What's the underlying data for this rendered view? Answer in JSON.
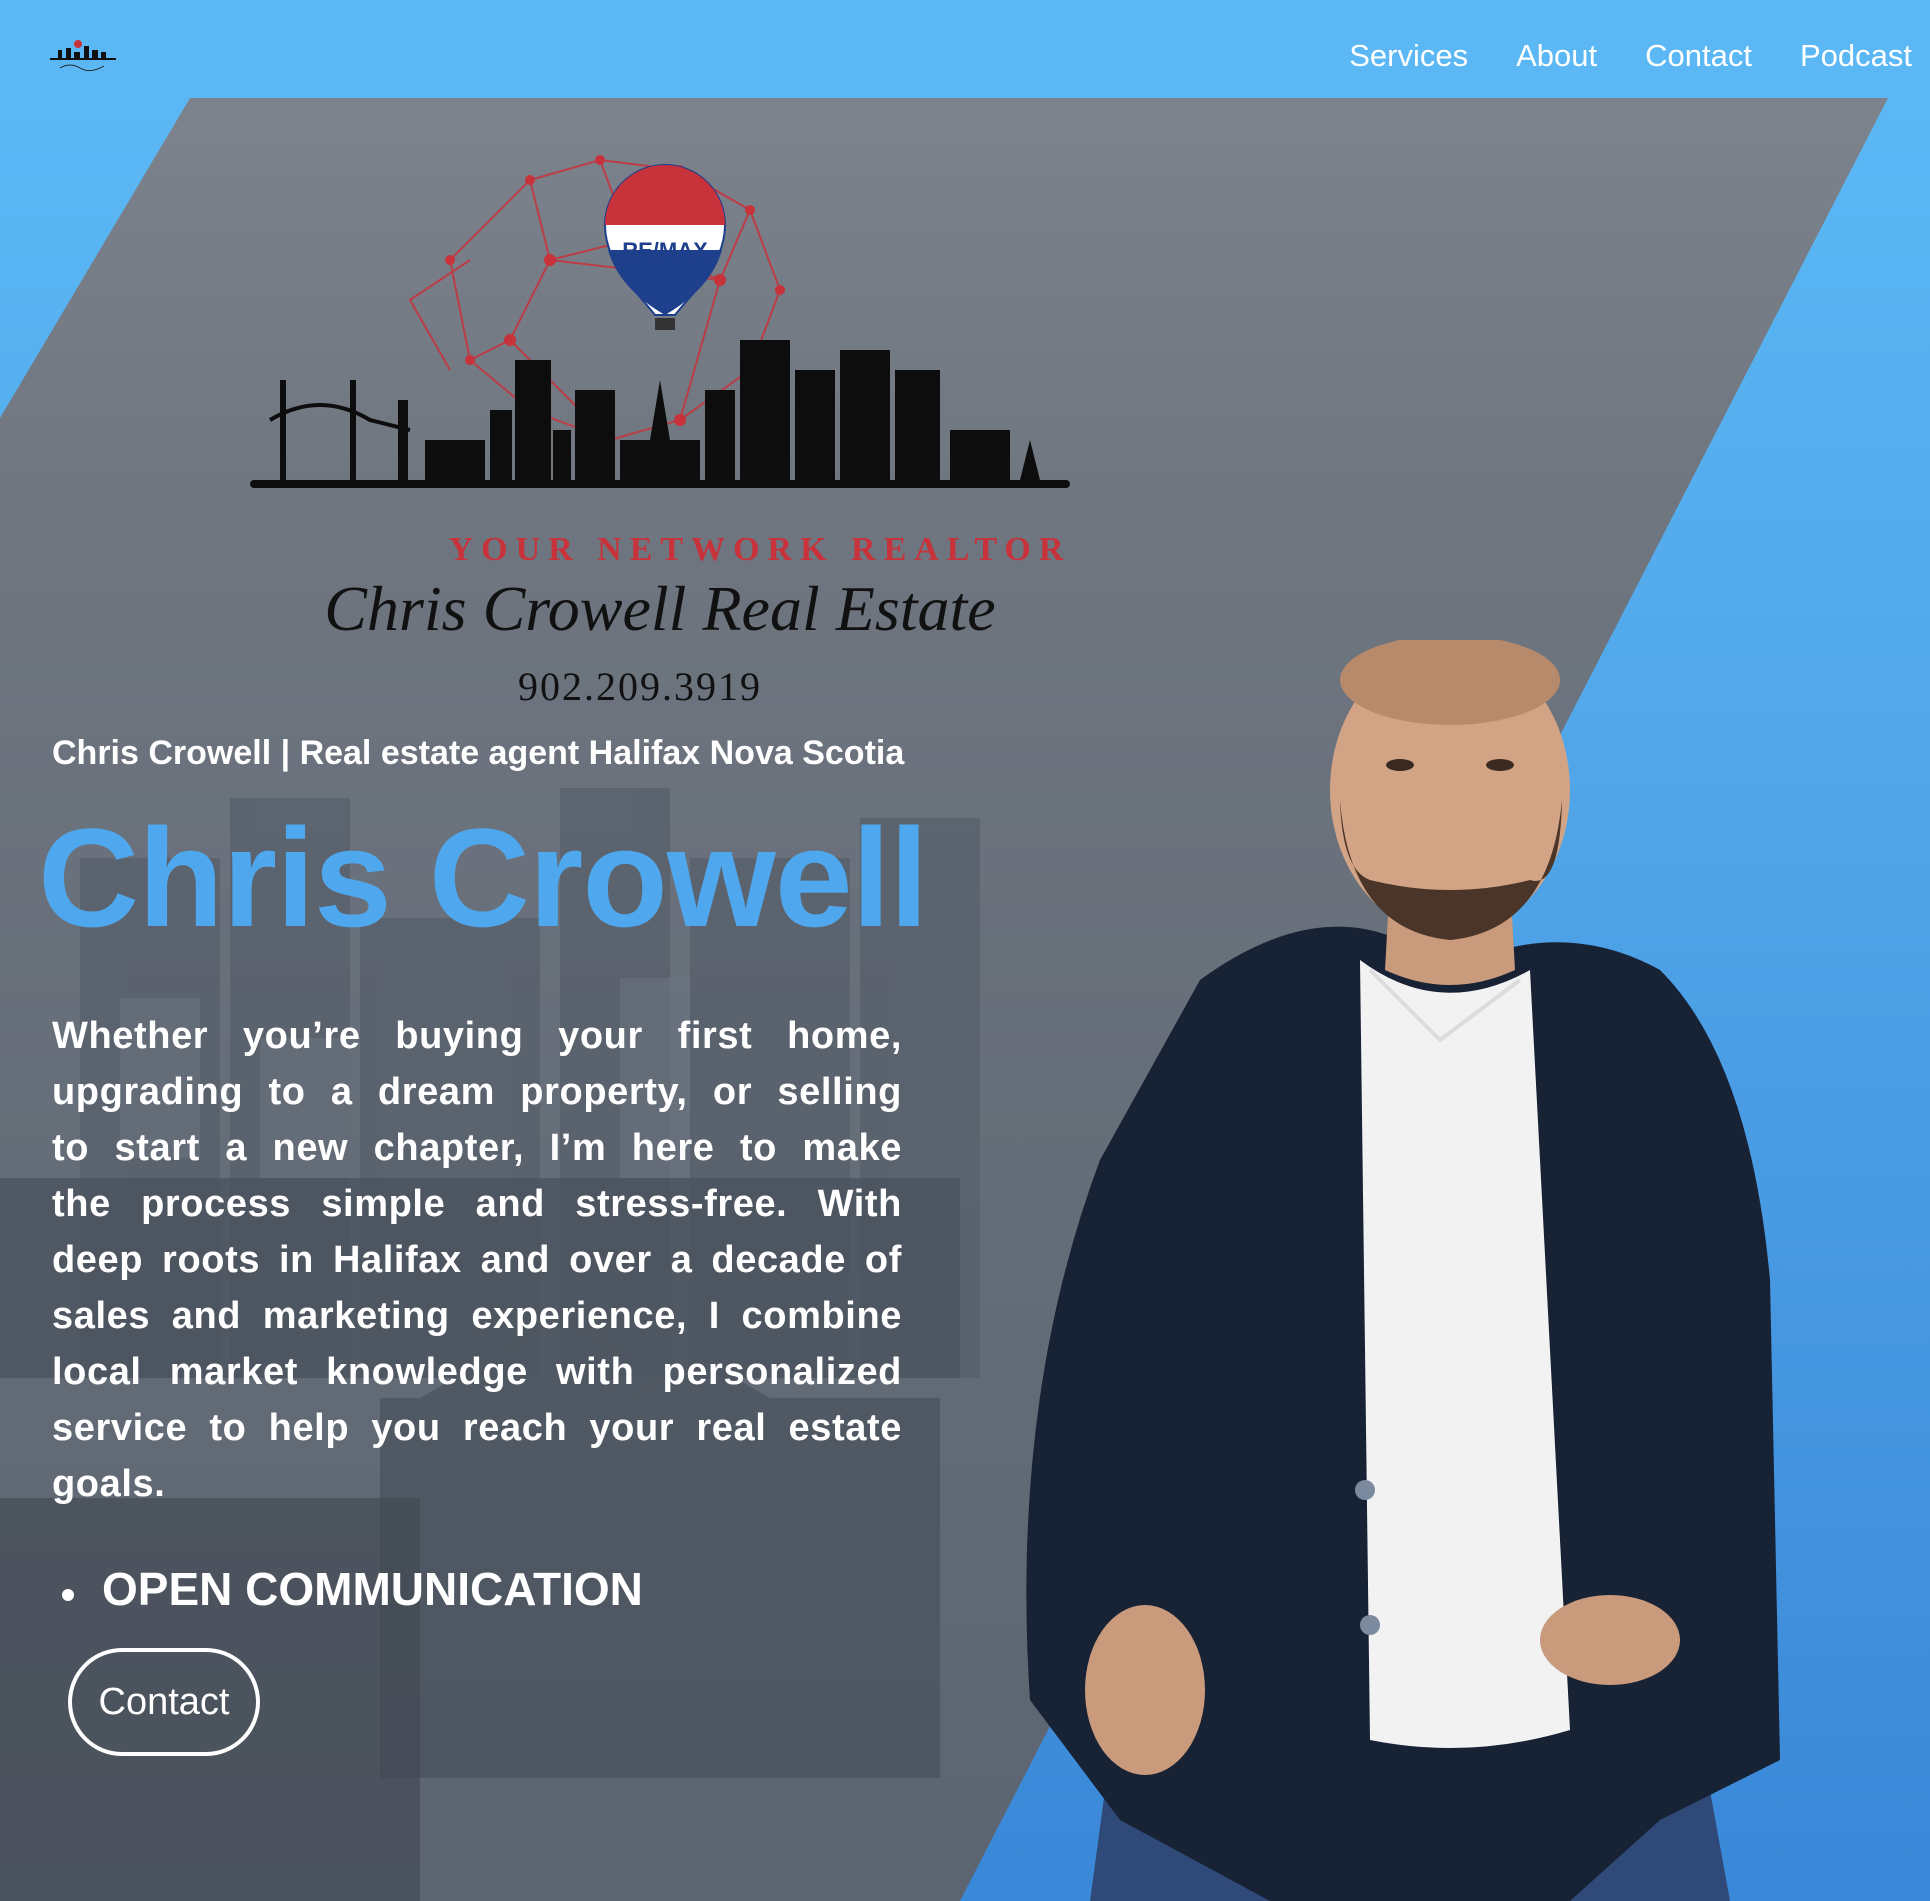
{
  "nav": {
    "links": [
      "Services",
      "About",
      "Contact",
      "Podcast"
    ]
  },
  "brand": {
    "balloon_text": "RE/MAX",
    "tagline": "YOUR NETWORK REALTOR",
    "script_name": "Chris Crowell Real Estate",
    "phone": "902.209.3919"
  },
  "hero": {
    "subtitle": "Chris Crowell | Real estate agent Halifax Nova Scotia",
    "title": "Chris Crowell",
    "paragraph": "Whether you’re buying your first home, upgrading to a dream property, or selling to start a new chapter, I’m here to make the process simple and stress-free. With deep roots in Halifax and over a decade of sales and marketing experience, I combine local market knowledge with personalized service to help you reach your real estate goals.",
    "bullet": "OPEN COMMUNICATION",
    "cta_label": "Contact"
  },
  "colors": {
    "accent": "#5bb8f5",
    "title_blue": "#4fa8ee",
    "tagline_red": "#c8323a",
    "remax_blue": "#1e3f8c"
  }
}
